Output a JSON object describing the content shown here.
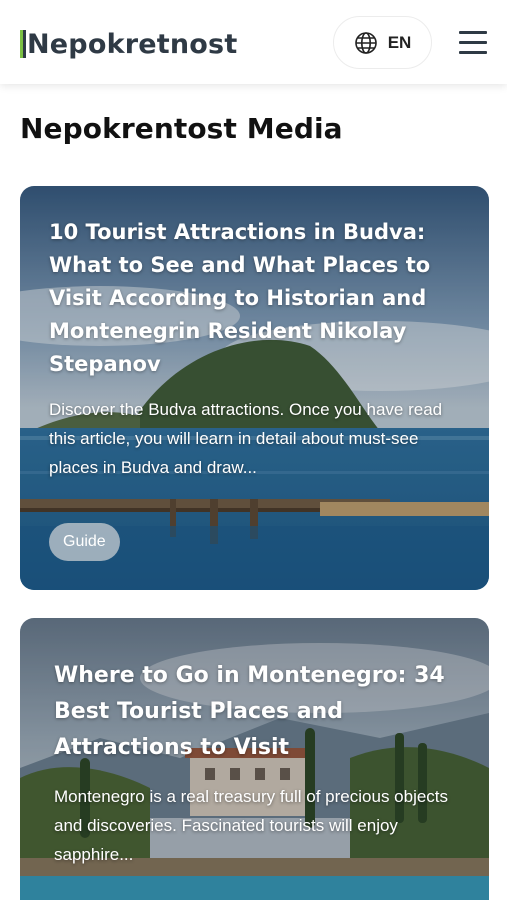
{
  "header": {
    "logo_text": "Nepokretnost",
    "language_label": "EN"
  },
  "page": {
    "title": "Nepokrentost Media"
  },
  "articles": [
    {
      "title": "10 Tourist Attractions in Budva: What to See and What Places to Visit According to Historian and Montenegrin Resident Nikolay Stepanov",
      "description": "Discover the Budva attractions. Once you have read this article, you will learn in detail about must-see places in Budva and draw...",
      "tag": "Guide"
    },
    {
      "title": "Where to Go in Montenegro: 34 Best Tourist Places and Attractions to Visit",
      "description": "Montenegro is a real treasury full of precious objects and discoveries. Fascinated tourists will enjoy sapphire..."
    }
  ],
  "colors": {
    "brand_green": "#7bc043",
    "brand_dark": "#2f3a45"
  }
}
